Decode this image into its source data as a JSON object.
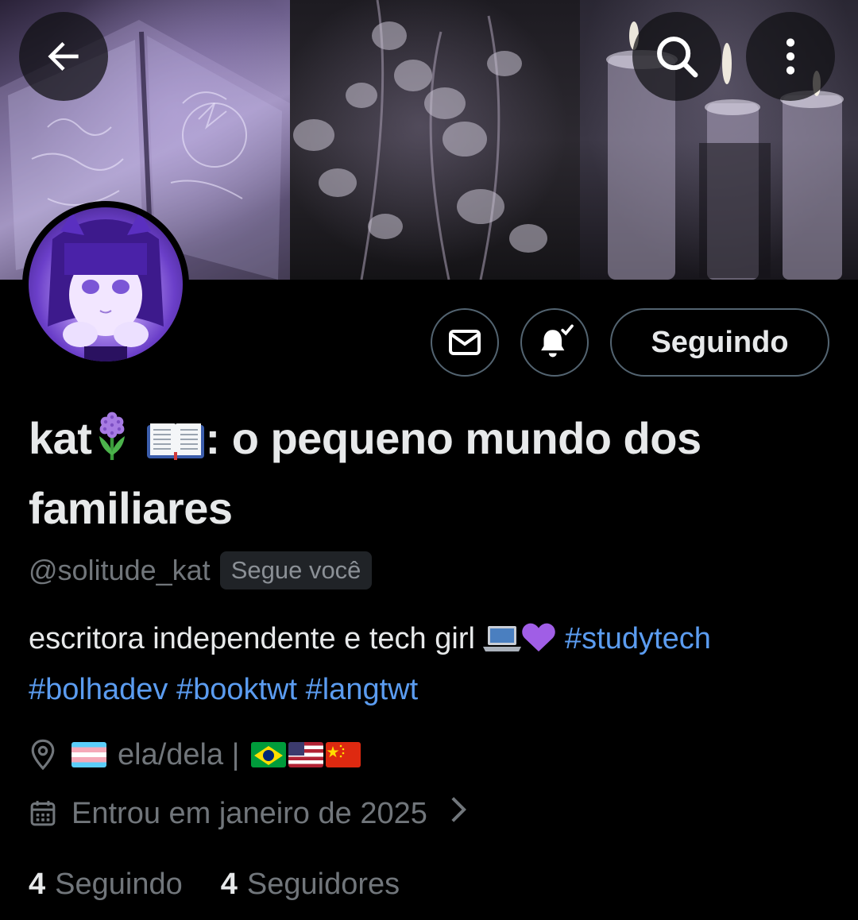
{
  "header": {
    "back_icon": "arrow-left-icon",
    "search_icon": "search-icon",
    "more_icon": "more-vertical-icon"
  },
  "actions": {
    "message_icon": "mail-icon",
    "notify_icon": "bell-check-icon",
    "following_label": "Seguindo"
  },
  "profile": {
    "name_prefix": "kat",
    "name_suffix": ": o pequeno mundo dos familiares",
    "name_emojis": [
      "hyacinth",
      "open-book"
    ],
    "handle": "@solitude_kat",
    "follows_you": "Segue você",
    "bio_text": "escritora independente e tech girl",
    "bio_emojis": [
      "laptop",
      "purple-heart"
    ],
    "hashtags": [
      "#studytech",
      "#bolhadev",
      "#booktwt",
      "#langtwt"
    ],
    "location": "ela/dela |",
    "location_flags": [
      "transgender-flag",
      "brazil-flag",
      "usa-flag",
      "china-flag"
    ],
    "joined": "Entrou em janeiro de 2025"
  },
  "stats": {
    "following_count": "4",
    "following_label": "Seguindo",
    "followers_count": "4",
    "followers_label": "Seguidores"
  },
  "colors": {
    "background": "#000000",
    "text_primary": "#e7e9ea",
    "text_secondary": "#71767b",
    "link": "#5b9cf0",
    "border": "#536471",
    "badge_bg": "#202327"
  }
}
